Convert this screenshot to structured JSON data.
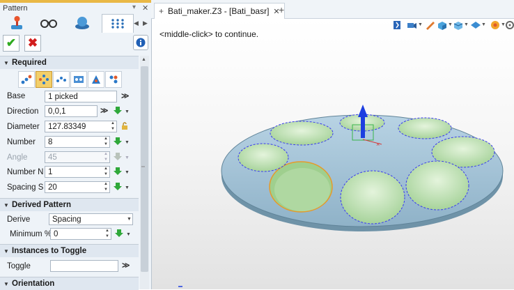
{
  "panel": {
    "title": "Pattern",
    "tabs": [
      {
        "name": "required-tab",
        "icon": "joystick-icon"
      },
      {
        "name": "glasses-tab",
        "icon": "glasses-icon"
      },
      {
        "name": "shapes-tab",
        "icon": "shapes-icon"
      },
      {
        "name": "pattern-tab",
        "icon": "grid-dots-icon",
        "active": true
      }
    ]
  },
  "sections": {
    "required": "Required",
    "derived": "Derived Pattern",
    "toggle": "Instances to Toggle",
    "orientation": "Orientation"
  },
  "fields": {
    "base": {
      "label": "Base",
      "value": "1 picked"
    },
    "direction": {
      "label": "Direction",
      "value": "0,0,1"
    },
    "diameter": {
      "label": "Diameter",
      "value": "127.83349"
    },
    "number": {
      "label": "Number",
      "value": "8"
    },
    "angle": {
      "label": "Angle",
      "value": "45"
    },
    "number_n": {
      "label": "Number  N",
      "value": "1"
    },
    "spacing_s": {
      "label": "Spacing  S",
      "value": "20"
    },
    "derive": {
      "label": "Derive",
      "value": "Spacing"
    },
    "minimum": {
      "label": "Minimum %",
      "value": "0"
    },
    "toggle": {
      "label": "Toggle",
      "value": ""
    }
  },
  "document": {
    "tab_title": "Bati_maker.Z3 - [Bati_basr]",
    "hint": "<middle-click> to continue."
  },
  "colors": {
    "accent": "#e9b846",
    "ok": "#2eaa1f",
    "cancel": "#d21d1d",
    "plate": "#a9c6d8",
    "pocket": "#bfe3b7",
    "axis_z": "#1d3fe0"
  }
}
